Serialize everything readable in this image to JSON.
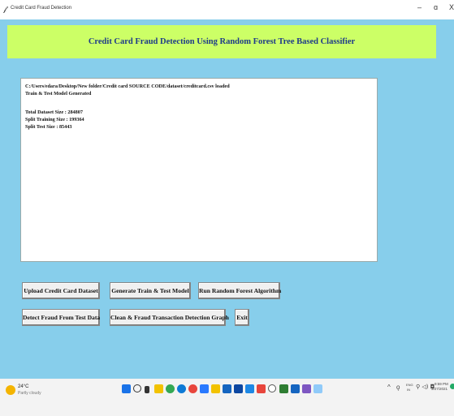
{
  "window": {
    "title": "Credit Card Fraud Detection",
    "minimize_glyph": "–",
    "maximize_glyph": "ɑ",
    "close_glyph": "X"
  },
  "header": {
    "title": "Credit Card Fraud Detection Using Random Forest Tree Based Classifier",
    "banner_color": "#ccff66",
    "title_color": "#1e3a8a"
  },
  "app_background": "#87ceeb",
  "output": {
    "lines": [
      "C:/Users/edara/Desktop/New folder/Credit card SOURCE CODE/dataset/creditcard.csv loaded",
      "Train & Test Model Generated",
      "Total Dataset Size : 284807",
      "Split Training Size : 199364",
      "Split Test Size : 85443"
    ]
  },
  "buttons": {
    "upload": "Upload Credit Card Dataset",
    "generate": "Generate Train & Test Model",
    "run_rf": "Run Random Forest Algorithm",
    "detect": "Detect Fraud From Test Data",
    "graph": "Clean & Fraud Transaction Detection Graph",
    "exit": "Exit"
  },
  "taskbar": {
    "weather_temp": "24°C",
    "weather_desc": "Partly cloudy",
    "lang_top": "ENG",
    "lang_bottom": "IN",
    "time": "9:59 PM",
    "date": "3/27/2021",
    "icons": [
      "start-icon",
      "search-icon",
      "task-view-icon",
      "file-explorer-icon",
      "chrome-icon",
      "edge-icon",
      "vscode-icon",
      "store-icon",
      "mail-icon",
      "settings-icon",
      "office-icon",
      "app-icon",
      "browser-icon",
      "terminal-icon",
      "notes-icon",
      "paint-icon",
      "extra-icon"
    ]
  }
}
